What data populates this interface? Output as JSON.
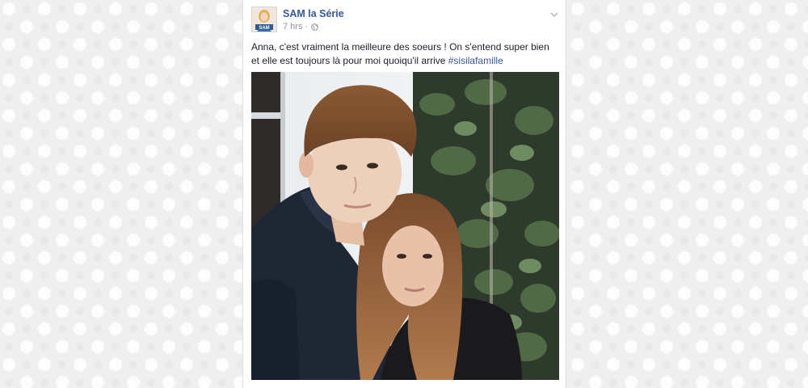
{
  "post": {
    "page_name": "SAM la Série",
    "timestamp": "7 hrs",
    "separator": "·",
    "privacy_icon": "globe-icon",
    "menu_icon": "chevron-down-icon",
    "text": "Anna, c'est vraiment la meilleure des soeurs ! On s'entend super bien et elle est toujours là pour moi quoiqu'il arrive ",
    "hashtag": "#sisilafamille",
    "avatar": {
      "icon": "page-avatar",
      "logo_text": "SAM"
    },
    "photo": {
      "icon": "selfie-photo"
    }
  },
  "colors": {
    "link": "#365899",
    "meta": "#90949c",
    "text": "#1d2129",
    "background": "#efefef"
  }
}
